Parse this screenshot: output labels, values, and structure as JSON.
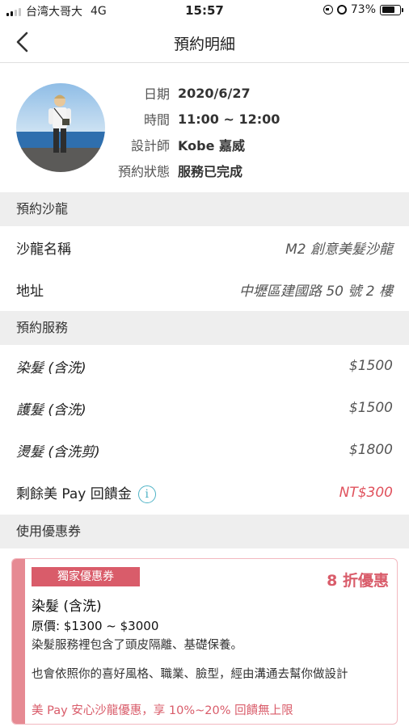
{
  "status_bar": {
    "carrier": "台湾大哥大",
    "network": "4G",
    "time": "15:57",
    "battery": "73%",
    "battery_level": 0.73
  },
  "nav": {
    "title": "預約明細"
  },
  "appointment": {
    "date_label": "日期",
    "date_value": "2020/6/27",
    "time_label": "時間",
    "time_value": "11:00 ~ 12:00",
    "designer_label": "設計師",
    "designer_value": "Kobe 嘉威",
    "status_label": "預約狀態",
    "status_value": "服務已完成"
  },
  "salon_section": {
    "header": "預約沙龍",
    "name_label": "沙龍名稱",
    "name_value": "M2 創意美髮沙龍",
    "address_label": "地址",
    "address_value": "中壢區建國路 50 號 2 樓"
  },
  "service_section": {
    "header": "預約服務",
    "items": [
      {
        "label": "染髮 (含洗)",
        "price": "$1500"
      },
      {
        "label": "護髮 (含洗)",
        "price": "$1500"
      },
      {
        "label": "燙髮 (含洗剪)",
        "price": "$1800"
      }
    ],
    "cashback_label": "剩餘美 Pay 回饋金",
    "cashback_value": "NT$300"
  },
  "coupon_section": {
    "header": "使用優惠券",
    "tag": "獨家優惠券",
    "discount": "8 折優惠",
    "title": "染髮 (含洗)",
    "price": "原價: $1300 ~ $3000",
    "desc1": "染髮服務裡包含了頭皮隔離、基礎保養。",
    "desc2": "也會依照你的喜好風格、職業、臉型，經由溝通去幫你做設計",
    "promo": "美 Pay 安心沙龍優惠，享 10%~20% 回饋無上限"
  },
  "colors": {
    "accent_red": "#d95c6a",
    "info_teal": "#4fb3c6"
  }
}
